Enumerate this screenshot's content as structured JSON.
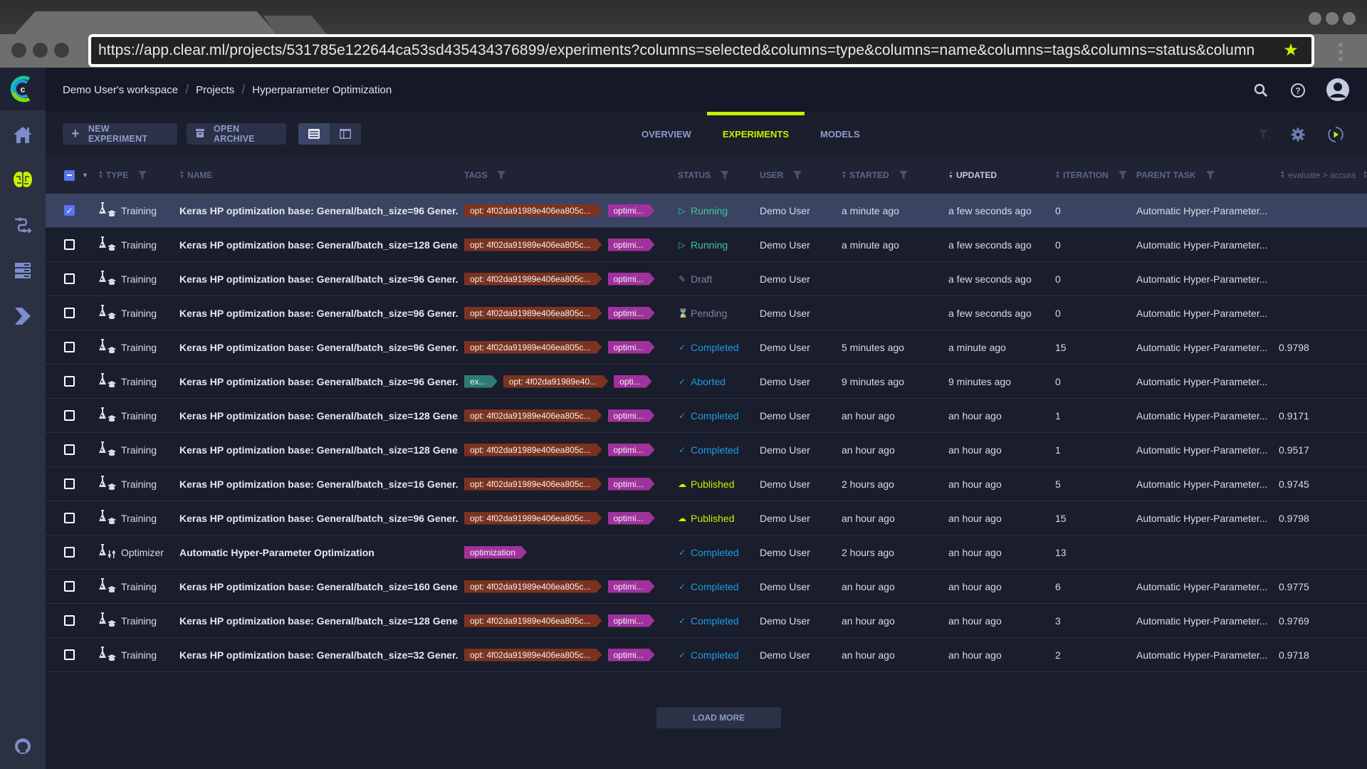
{
  "browser": {
    "url": "https://app.clear.ml/projects/531785e122644ca53sd435434376899/experiments?columns=selected&columns=type&columns=name&columns=tags&columns=status&column",
    "bookmark_icon": "star-icon",
    "menu_icon": "kebab-icon"
  },
  "sidebar": {
    "logo": "clearml-logo",
    "items": [
      {
        "name": "home",
        "icon": "home-icon",
        "active": false
      },
      {
        "name": "projects",
        "icon": "brain-icon",
        "active": true
      },
      {
        "name": "pipelines",
        "icon": "pipeline-icon",
        "active": false
      },
      {
        "name": "datasets",
        "icon": "server-icon",
        "active": false
      },
      {
        "name": "orchestration",
        "icon": "chevron-right-icon",
        "active": false
      }
    ],
    "footer_icon": "github-icon"
  },
  "header": {
    "breadcrumb": [
      "Demo User's workspace",
      "Projects",
      "Hyperparameter Optimization"
    ],
    "separator": "/",
    "icons": [
      "search-icon",
      "help-icon",
      "user-avatar"
    ]
  },
  "toolbar": {
    "new_experiment": "NEW EXPERIMENT",
    "open_archive": "OPEN ARCHIVE",
    "tabs": [
      {
        "label": "OVERVIEW",
        "active": false
      },
      {
        "label": "EXPERIMENTS",
        "active": true
      },
      {
        "label": "MODELS",
        "active": false
      }
    ],
    "accent_color": "#c8f000"
  },
  "table": {
    "columns": {
      "type": "TYPE",
      "name": "NAME",
      "tags": "TAGS",
      "status": "STATUS",
      "user": "USER",
      "started": "STARTED",
      "updated": "UPDATED",
      "iteration": "ITERATION",
      "parent": "PARENT TASK",
      "metric": "evaluate > accura"
    },
    "rows": [
      {
        "selected": true,
        "type": "Training",
        "name": "Keras HP optimization base: General/batch_size=96 Gener...",
        "tags": [
          {
            "text": "opt: 4f02da91989e406ea805c...",
            "color": "#7b3320"
          },
          {
            "text": "optimi...",
            "color": "#a0329e"
          }
        ],
        "status": "Running",
        "user": "Demo User",
        "started": "a minute ago",
        "updated": "a few seconds ago",
        "iteration": "0",
        "parent": "Automatic Hyper-Parameter...",
        "metric": ""
      },
      {
        "selected": false,
        "type": "Training",
        "name": "Keras HP optimization base: General/batch_size=128 Gene...",
        "tags": [
          {
            "text": "opt: 4f02da91989e406ea805c...",
            "color": "#7b3320"
          },
          {
            "text": "optimi...",
            "color": "#a0329e"
          }
        ],
        "status": "Running",
        "user": "Demo User",
        "started": "a minute ago",
        "updated": "a few seconds ago",
        "iteration": "0",
        "parent": "Automatic Hyper-Parameter...",
        "metric": ""
      },
      {
        "selected": false,
        "type": "Training",
        "name": "Keras HP optimization base: General/batch_size=96 Gener...",
        "tags": [
          {
            "text": "opt: 4f02da91989e406ea805c...",
            "color": "#7b3320"
          },
          {
            "text": "optimi...",
            "color": "#a0329e"
          }
        ],
        "status": "Draft",
        "user": "Demo User",
        "started": "",
        "updated": "a few seconds ago",
        "iteration": "0",
        "parent": "Automatic Hyper-Parameter...",
        "metric": ""
      },
      {
        "selected": false,
        "type": "Training",
        "name": "Keras HP optimization base: General/batch_size=96 Gener...",
        "tags": [
          {
            "text": "opt: 4f02da91989e406ea805c...",
            "color": "#7b3320"
          },
          {
            "text": "optimi...",
            "color": "#a0329e"
          }
        ],
        "status": "Pending",
        "user": "Demo User",
        "started": "",
        "updated": "a few seconds ago",
        "iteration": "0",
        "parent": "Automatic Hyper-Parameter...",
        "metric": ""
      },
      {
        "selected": false,
        "type": "Training",
        "name": "Keras HP optimization base: General/batch_size=96 Gener...",
        "tags": [
          {
            "text": "opt: 4f02da91989e406ea805c...",
            "color": "#7b3320"
          },
          {
            "text": "optimi...",
            "color": "#a0329e"
          }
        ],
        "status": "Completed",
        "user": "Demo User",
        "started": "5 minutes ago",
        "updated": "a minute ago",
        "iteration": "15",
        "parent": "Automatic Hyper-Parameter...",
        "metric": "0.9798"
      },
      {
        "selected": false,
        "type": "Training",
        "name": "Keras HP optimization base: General/batch_size=96 Gener...",
        "tags": [
          {
            "text": "ex...",
            "color": "#2f7a74"
          },
          {
            "text": "opt: 4f02da91989e40...",
            "color": "#7b3320"
          },
          {
            "text": "opti...",
            "color": "#a0329e"
          }
        ],
        "status": "Aborted",
        "user": "Demo User",
        "started": "9 minutes ago",
        "updated": "9 minutes ago",
        "iteration": "0",
        "parent": "Automatic Hyper-Parameter...",
        "metric": ""
      },
      {
        "selected": false,
        "type": "Training",
        "name": "Keras HP optimization base: General/batch_size=128 Gene...",
        "tags": [
          {
            "text": "opt: 4f02da91989e406ea805c...",
            "color": "#7b3320"
          },
          {
            "text": "optimi...",
            "color": "#a0329e"
          }
        ],
        "status": "Completed",
        "user": "Demo User",
        "started": "an hour ago",
        "updated": "an hour ago",
        "iteration": "1",
        "parent": "Automatic Hyper-Parameter...",
        "metric": "0.9171"
      },
      {
        "selected": false,
        "type": "Training",
        "name": "Keras HP optimization base: General/batch_size=128 Gene...",
        "tags": [
          {
            "text": "opt: 4f02da91989e406ea805c...",
            "color": "#7b3320"
          },
          {
            "text": "optimi...",
            "color": "#a0329e"
          }
        ],
        "status": "Completed",
        "user": "Demo User",
        "started": "an hour ago",
        "updated": "an hour ago",
        "iteration": "1",
        "parent": "Automatic Hyper-Parameter...",
        "metric": "0.9517"
      },
      {
        "selected": false,
        "type": "Training",
        "name": "Keras HP optimization base: General/batch_size=16 Gener...",
        "tags": [
          {
            "text": "opt: 4f02da91989e406ea805c...",
            "color": "#7b3320"
          },
          {
            "text": "optimi...",
            "color": "#a0329e"
          }
        ],
        "status": "Published",
        "user": "Demo User",
        "started": "2 hours ago",
        "updated": "an hour ago",
        "iteration": "5",
        "parent": "Automatic Hyper-Parameter...",
        "metric": "0.9745"
      },
      {
        "selected": false,
        "type": "Training",
        "name": "Keras HP optimization base: General/batch_size=96 Gener...",
        "tags": [
          {
            "text": "opt: 4f02da91989e406ea805c...",
            "color": "#7b3320"
          },
          {
            "text": "optimi...",
            "color": "#a0329e"
          }
        ],
        "status": "Published",
        "user": "Demo User",
        "started": "an hour ago",
        "updated": "an hour ago",
        "iteration": "15",
        "parent": "Automatic Hyper-Parameter...",
        "metric": "0.9798"
      },
      {
        "selected": false,
        "type": "Optimizer",
        "name": "Automatic Hyper-Parameter Optimization",
        "tags": [
          {
            "text": "optimization",
            "color": "#a0329e"
          }
        ],
        "status": "Completed",
        "user": "Demo User",
        "started": "2 hours ago",
        "updated": "an hour ago",
        "iteration": "13",
        "parent": "",
        "metric": ""
      },
      {
        "selected": false,
        "type": "Training",
        "name": "Keras HP optimization base: General/batch_size=160 Gene...",
        "tags": [
          {
            "text": "opt: 4f02da91989e406ea805c...",
            "color": "#7b3320"
          },
          {
            "text": "optimi...",
            "color": "#a0329e"
          }
        ],
        "status": "Completed",
        "user": "Demo User",
        "started": "an hour ago",
        "updated": "an hour ago",
        "iteration": "6",
        "parent": "Automatic Hyper-Parameter...",
        "metric": "0.9775"
      },
      {
        "selected": false,
        "type": "Training",
        "name": "Keras HP optimization base: General/batch_size=128 Gene...",
        "tags": [
          {
            "text": "opt: 4f02da91989e406ea805c...",
            "color": "#7b3320"
          },
          {
            "text": "optimi...",
            "color": "#a0329e"
          }
        ],
        "status": "Completed",
        "user": "Demo User",
        "started": "an hour ago",
        "updated": "an hour ago",
        "iteration": "3",
        "parent": "Automatic Hyper-Parameter...",
        "metric": "0.9769"
      },
      {
        "selected": false,
        "type": "Training",
        "name": "Keras HP optimization base: General/batch_size=32 Gener...",
        "tags": [
          {
            "text": "opt: 4f02da91989e406ea805c...",
            "color": "#7b3320"
          },
          {
            "text": "optimi...",
            "color": "#a0329e"
          }
        ],
        "status": "Completed",
        "user": "Demo User",
        "started": "an hour ago",
        "updated": "an hour ago",
        "iteration": "2",
        "parent": "Automatic Hyper-Parameter...",
        "metric": "0.9718"
      }
    ]
  },
  "status_styles": {
    "Running": {
      "icon": "▷",
      "color": "#3fc9a5",
      "icon_name": "play-icon"
    },
    "Draft": {
      "icon": "✎",
      "color": "#7b84a3",
      "icon_name": "pencil-icon"
    },
    "Pending": {
      "icon": "⌛",
      "color": "#7b84a3",
      "icon_name": "hourglass-icon"
    },
    "Completed": {
      "icon": "✓",
      "color": "#1e9be8",
      "icon_name": "check-icon"
    },
    "Aborted": {
      "icon": "✓",
      "color": "#1e9be8",
      "icon_name": "check-icon"
    },
    "Published": {
      "icon": "☁",
      "color": "#c8f000",
      "icon_name": "cloud-icon"
    }
  },
  "load_more": "LOAD MORE"
}
